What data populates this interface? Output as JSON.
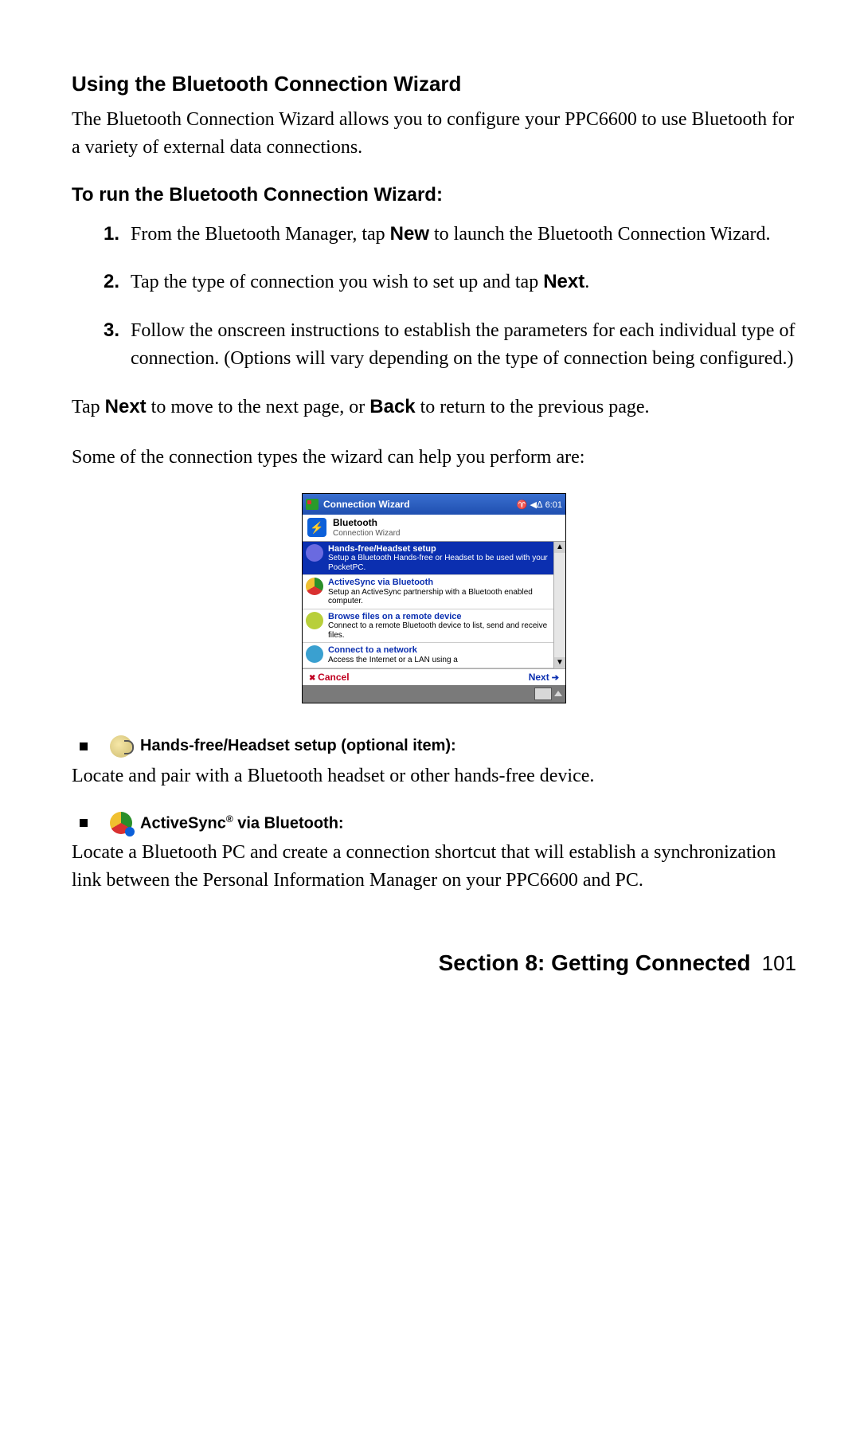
{
  "heading": "Using the Bluetooth Connection Wizard",
  "intro": "The Bluetooth Connection Wizard allows you to configure your PPC6600 to use Bluetooth for a variety of external data connections.",
  "subheading": "To run the Bluetooth Connection Wizard:",
  "steps": [
    {
      "num": "1.",
      "pre": "From the Bluetooth Manager, tap ",
      "bold": "New",
      "post": " to launch the Bluetooth Connection Wizard."
    },
    {
      "num": "2.",
      "pre": "Tap the type of connection you wish to set up and tap ",
      "bold": "Next",
      "post": "."
    },
    {
      "num": "3.",
      "pre": "Follow the onscreen instructions to establish the parameters for each individual type of connection. (Options will vary depending on the type of connection being configured.)",
      "bold": "",
      "post": ""
    }
  ],
  "navline": {
    "pre": "Tap ",
    "b1": "Next",
    "mid": " to move to the next page, or ",
    "b2": "Back",
    "post": " to return to the previous page."
  },
  "leadin": "Some of the connection types the wizard can help you perform are:",
  "screenshot": {
    "titlebar": {
      "title": "Connection Wizard",
      "status": "♈ ◀ᐃ 6:01"
    },
    "header": {
      "line1": "Bluetooth",
      "line2": "Connection Wizard"
    },
    "items": [
      {
        "title": "Hands-free/Headset setup",
        "desc": "Setup a Bluetooth Hands-free or Headset to be used with your PocketPC.",
        "selected": true,
        "iconColor": "#6a6ae0"
      },
      {
        "title": "ActiveSync via Bluetooth",
        "desc": "Setup an ActiveSync partnership with a Bluetooth enabled computer.",
        "selected": false,
        "iconColor": "#d04040"
      },
      {
        "title": "Browse files on a remote device",
        "desc": "Connect to a remote Bluetooth device to list, send and receive files.",
        "selected": false,
        "iconColor": "#b8cf3a"
      },
      {
        "title": "Connect to a network",
        "desc": "Access the Internet or a LAN using a",
        "selected": false,
        "iconColor": "#3aa0d0"
      }
    ],
    "cancel": "Cancel",
    "next": "Next"
  },
  "options": [
    {
      "label_pre": "Hands-free/Headset setup (optional item):",
      "label_sup": "",
      "label_post": "",
      "iconClass": "ico-headset",
      "desc": "Locate and pair with a Bluetooth headset or other hands-free device."
    },
    {
      "label_pre": "ActiveSync",
      "label_sup": "®",
      "label_post": " via Bluetooth:",
      "iconClass": "ico-activesync",
      "desc": "Locate a Bluetooth PC and create a connection shortcut that will establish a synchronization link between the Personal Information Manager on your PPC6600 and PC."
    }
  ],
  "footer": {
    "section": "Section 8: Getting Connected",
    "page": "101"
  }
}
